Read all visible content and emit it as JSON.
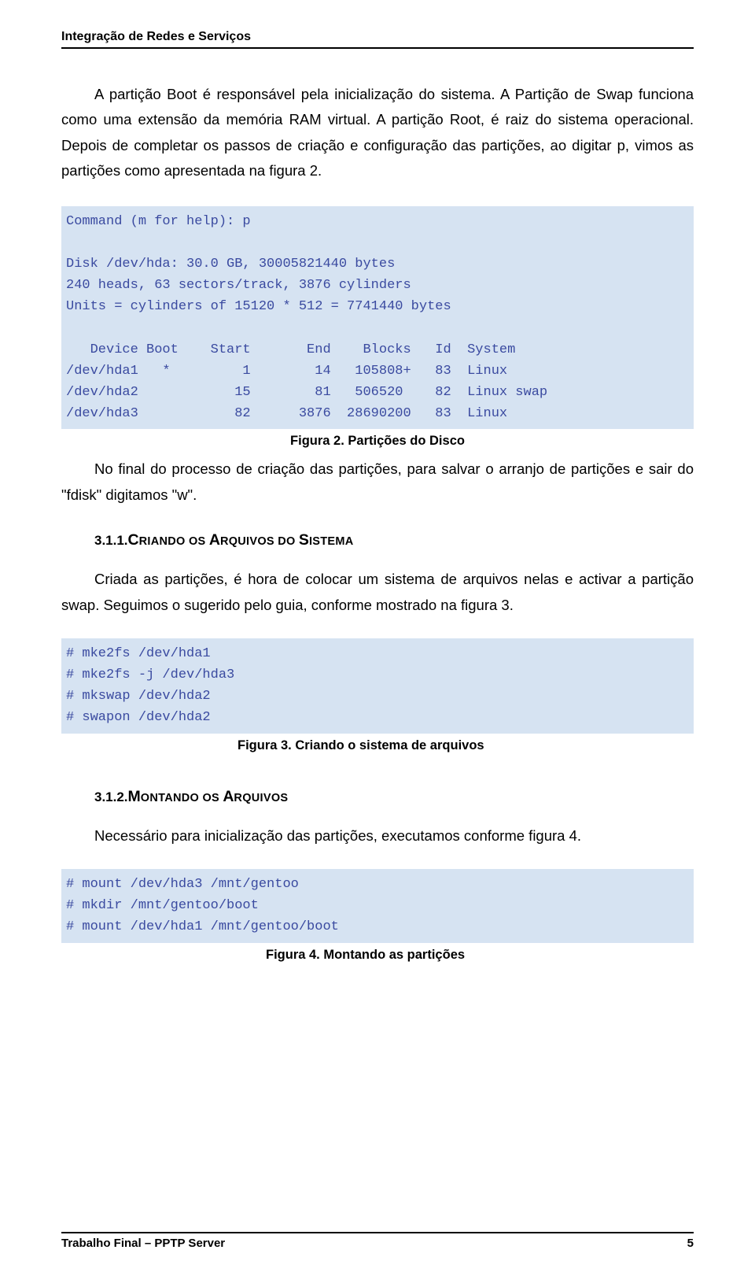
{
  "header": {
    "running_title": "Integração de Redes e Serviços"
  },
  "paragraphs": {
    "p1": "A partição Boot é responsável pela inicialização do sistema. A Partição de Swap funciona como uma extensão da memória RAM virtual. A partição Root, é raiz do sistema operacional. Depois de completar os passos de criação e configuração das partições, ao digitar p, vimos as partições como apresentada na figura 2.",
    "p2": "No final do processo de criação das partições, para salvar o arranjo de partições e sair do \"fdisk\" digitamos \"w\".",
    "p3": "Criada as partições, é hora de colocar um sistema de arquivos nelas e activar a partição swap. Seguimos o sugerido pelo guia, conforme mostrado na figura 3.",
    "p4": "Necessário para inicialização das partições, executamos conforme figura 4."
  },
  "code": {
    "figure2": "Command (m for help): p\n\nDisk /dev/hda: 30.0 GB, 30005821440 bytes\n240 heads, 63 sectors/track, 3876 cylinders\nUnits = cylinders of 15120 * 512 = 7741440 bytes\n\n   Device Boot    Start       End    Blocks   Id  System\n/dev/hda1   *         1        14   105808+   83  Linux\n/dev/hda2            15        81   506520    82  Linux swap\n/dev/hda3            82      3876  28690200   83  Linux",
    "figure3": "# mke2fs /dev/hda1\n# mke2fs -j /dev/hda3\n# mkswap /dev/hda2\n# swapon /dev/hda2",
    "figure4": "# mount /dev/hda3 /mnt/gentoo\n# mkdir /mnt/gentoo/boot\n# mount /dev/hda1 /mnt/gentoo/boot"
  },
  "captions": {
    "c2": "Figura 2. Partições do Disco",
    "c3": "Figura 3. Criando o sistema de arquivos",
    "c4": "Figura 4. Montando as partições"
  },
  "subsections": {
    "s311_num": "3.1.1.",
    "s311_big1": "C",
    "s311_sm1": "RIANDO OS ",
    "s311_big2": "A",
    "s311_sm2": "RQUIVOS DO ",
    "s311_big3": "S",
    "s311_sm3": "ISTEMA",
    "s312_num": "3.1.2.",
    "s312_big1": "M",
    "s312_sm1": "ONTANDO OS ",
    "s312_big2": "A",
    "s312_sm2": "RQUIVOS"
  },
  "footer": {
    "left": "Trabalho Final – PPTP Server",
    "right": "5"
  },
  "chart_data": {
    "type": "table",
    "title": "fdisk partition table for /dev/hda",
    "disk": {
      "path": "/dev/hda",
      "size_gb": 30.0,
      "size_bytes": 30005821440,
      "heads": 240,
      "sectors_per_track": 63,
      "cylinders": 3876,
      "unit_cylinders_bytes": 7741440
    },
    "columns": [
      "Device",
      "Boot",
      "Start",
      "End",
      "Blocks",
      "Id",
      "System"
    ],
    "rows": [
      {
        "Device": "/dev/hda1",
        "Boot": "*",
        "Start": 1,
        "End": 14,
        "Blocks": "105808+",
        "Id": "83",
        "System": "Linux"
      },
      {
        "Device": "/dev/hda2",
        "Boot": "",
        "Start": 15,
        "End": 81,
        "Blocks": "506520",
        "Id": "82",
        "System": "Linux swap"
      },
      {
        "Device": "/dev/hda3",
        "Boot": "",
        "Start": 82,
        "End": 3876,
        "Blocks": "28690200",
        "Id": "83",
        "System": "Linux"
      }
    ]
  }
}
